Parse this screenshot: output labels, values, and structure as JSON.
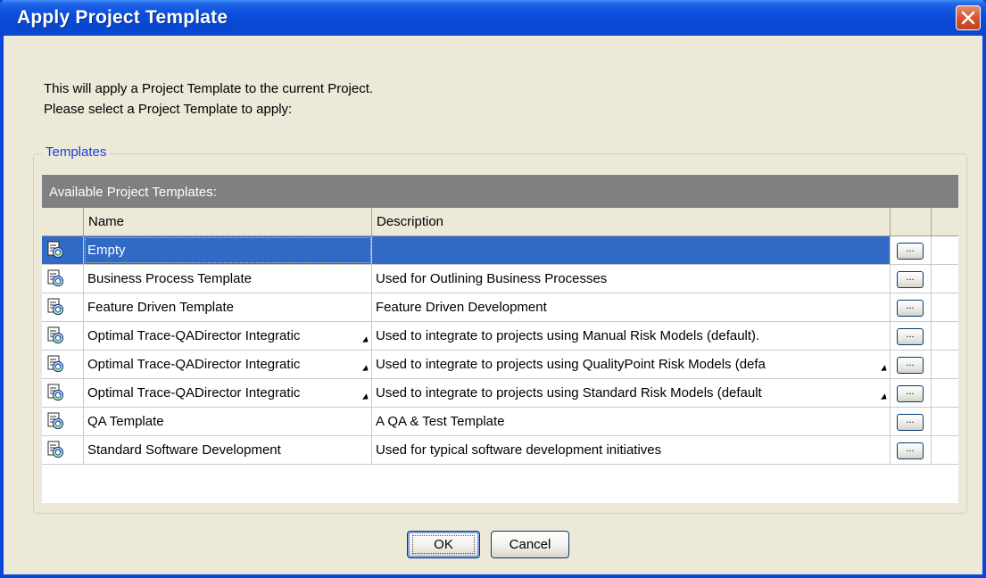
{
  "window": {
    "title": "Apply Project Template",
    "close_label": "Close"
  },
  "intro": {
    "line1": "This will apply a Project Template to the current Project.",
    "line2": "Please select a Project Template to apply:"
  },
  "group": {
    "label": "Templates",
    "caption": "Available Project Templates:",
    "columns": {
      "name": "Name",
      "description": "Description"
    },
    "selected_index": 0,
    "more_button_label": "...",
    "rows": [
      {
        "name": "Empty",
        "description": ""
      },
      {
        "name": "Business Process Template",
        "description": "Used for Outlining Business Processes"
      },
      {
        "name": "Feature Driven Template",
        "description": "Feature Driven Development"
      },
      {
        "name": "Optimal Trace-QADirector Integratic",
        "description": "Used to integrate to projects using Manual Risk Models (default)."
      },
      {
        "name": "Optimal Trace-QADirector Integratic",
        "description": "Used to integrate to projects using QualityPoint Risk Models (defa"
      },
      {
        "name": "Optimal Trace-QADirector Integratic",
        "description": "Used to integrate to projects using Standard Risk Models (default"
      },
      {
        "name": "QA Template",
        "description": "A QA & Test Template"
      },
      {
        "name": "Standard Software Development",
        "description": "Used for typical software development initiatives"
      }
    ]
  },
  "buttons": {
    "ok": "OK",
    "cancel": "Cancel"
  },
  "colors": {
    "titlebar": "#0a4fdc",
    "selection": "#316ac5",
    "caption_bg": "#808080",
    "group_label": "#1a3fd6"
  }
}
